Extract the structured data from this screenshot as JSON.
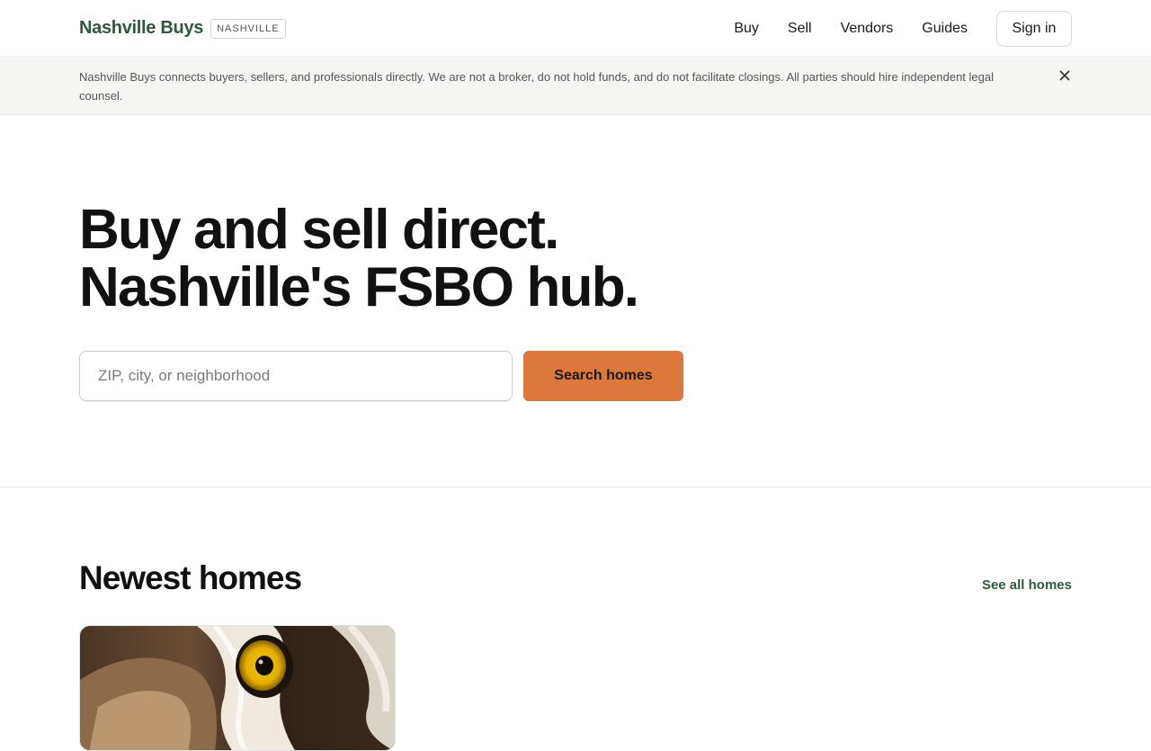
{
  "header": {
    "brand_name": "Nashville Buys",
    "brand_badge": "NASHVILLE",
    "nav": [
      "Buy",
      "Sell",
      "Vendors",
      "Guides"
    ],
    "signin_label": "Sign in"
  },
  "notice": {
    "text": "Nashville Buys connects buyers, sellers, and professionals directly. We are not a broker, do not hold funds, and do not facilitate closings. All parties should hire independent legal counsel.",
    "close_icon": "close-icon"
  },
  "hero": {
    "title_line1": "Buy and sell direct.",
    "title_line2": "Nashville's FSBO hub.",
    "search_placeholder": "ZIP, city, or neighborhood",
    "search_value": "",
    "search_button": "Search homes"
  },
  "newest": {
    "title": "Newest homes",
    "see_all": "See all homes"
  },
  "colors": {
    "brand": "#2d5a3d",
    "accent": "#dc783c",
    "notice_bg": "#f5f5f3"
  }
}
